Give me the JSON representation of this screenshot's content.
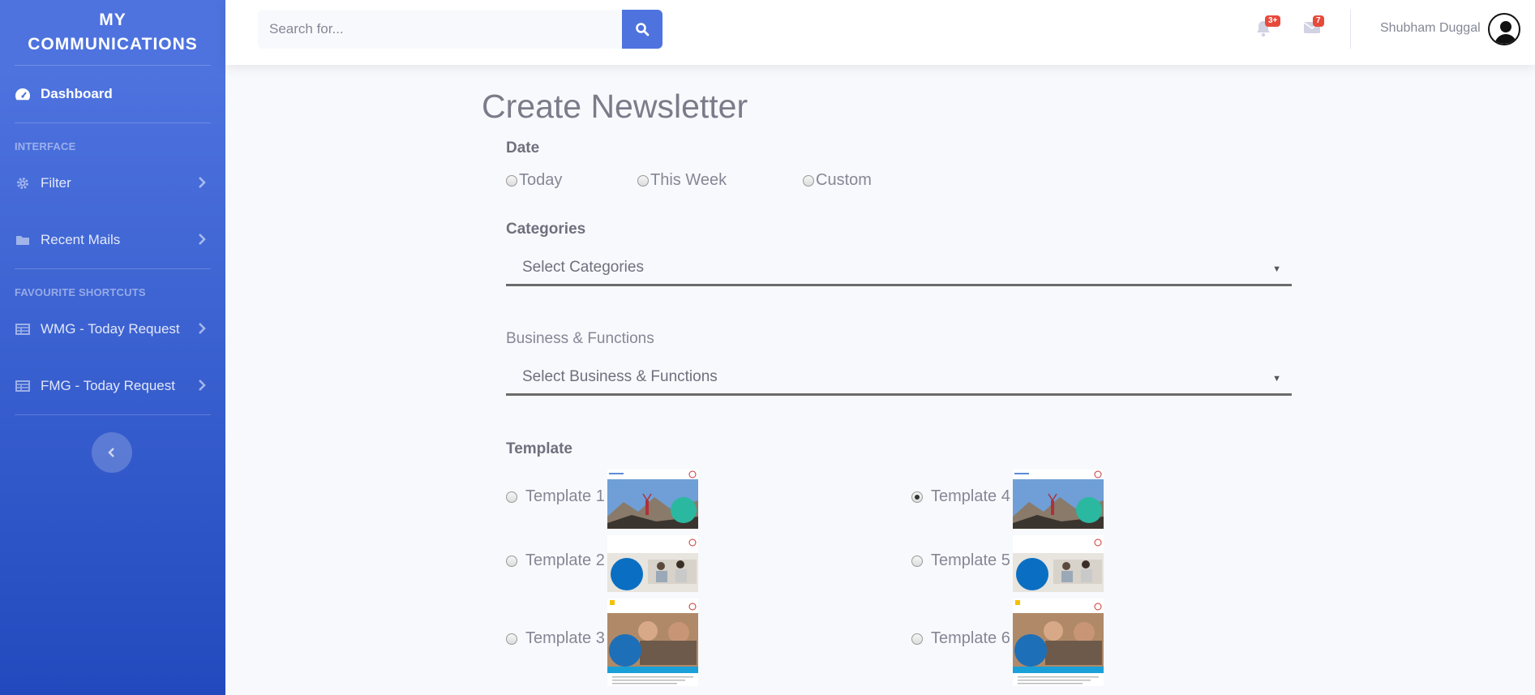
{
  "sidebar": {
    "brand_line1": "MY",
    "brand_line2": "COMMUNICATIONS",
    "dashboard": "Dashboard",
    "heading_interface": "INTERFACE",
    "filter": "Filter",
    "recent_mails": "Recent Mails",
    "heading_shortcuts": "FAVOURITE SHORTCUTS",
    "wmg": "WMG - Today Request",
    "fmg": "FMG - Today Request"
  },
  "topbar": {
    "search_placeholder": "Search for...",
    "alerts_badge": "3+",
    "messages_badge": "7",
    "user_name": "Shubham Duggal"
  },
  "form": {
    "title": "Create Newsletter",
    "date_label": "Date",
    "date_options": [
      "Today",
      "This Week",
      "Custom"
    ],
    "categories_label": "Categories",
    "categories_placeholder": "Select Categories",
    "business_label": "Business & Functions",
    "business_placeholder": "Select Business & Functions",
    "template_label": "Template",
    "templates": [
      "Template 1",
      "Template 2",
      "Template 3",
      "Template 4",
      "Template 5",
      "Template 6"
    ],
    "selected_template": "Template 4"
  },
  "colors": {
    "primary": "#4e73df",
    "sidebar_dark": "#224abe",
    "badge": "#e74a3b",
    "text": "#858796"
  }
}
